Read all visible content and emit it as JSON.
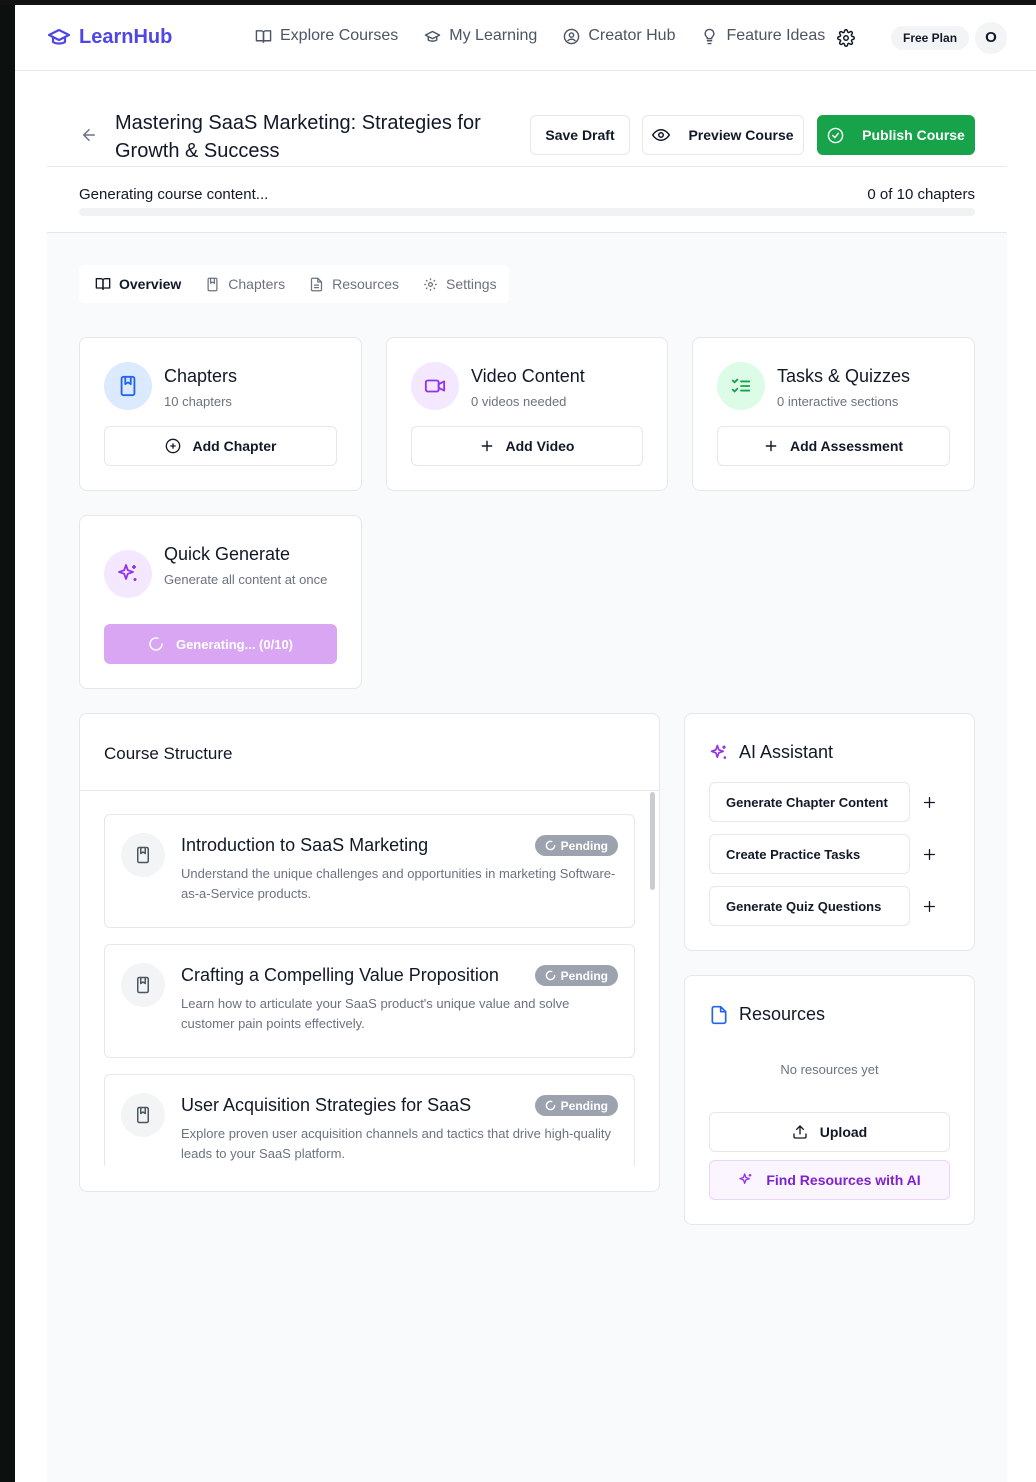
{
  "nav": {
    "brand": "LearnHub",
    "links": [
      {
        "label": "Explore Courses",
        "icon": "book-open-icon"
      },
      {
        "label": "My Learning",
        "icon": "graduation-cap-icon"
      },
      {
        "label": "Creator Hub",
        "icon": "user-circle-icon"
      },
      {
        "label": "Feature Ideas",
        "icon": "lightbulb-icon"
      }
    ],
    "plan": "Free Plan",
    "avatar_initial": "O"
  },
  "header": {
    "title": "Mastering SaaS Marketing: Strategies for Growth & Success",
    "save_label": "Save Draft",
    "preview_label": "Preview Course",
    "publish_label": "Publish Course",
    "progress_label": "Generating course content...",
    "progress_count": "0 of 10 chapters",
    "progress_fraction": 0
  },
  "tabs": [
    {
      "label": "Overview",
      "active": true
    },
    {
      "label": "Chapters",
      "active": false
    },
    {
      "label": "Resources",
      "active": false
    },
    {
      "label": "Settings",
      "active": false
    }
  ],
  "stats": {
    "chapters": {
      "title": "Chapters",
      "sub": "10 chapters",
      "button": "Add Chapter"
    },
    "videos": {
      "title": "Video Content",
      "sub": "0 videos needed",
      "button": "Add Video"
    },
    "tasks": {
      "title": "Tasks & Quizzes",
      "sub": "0 interactive sections",
      "button": "Add Assessment"
    },
    "quick": {
      "title": "Quick Generate",
      "sub": "Generate all content at once",
      "button": "Generating... (0/10)"
    }
  },
  "structure": {
    "title": "Course Structure",
    "chapters": [
      {
        "title": "Introduction to SaaS Marketing",
        "desc": "Understand the unique challenges and opportunities in marketing Software-as-a-Service products.",
        "status": "Pending"
      },
      {
        "title": "Crafting a Compelling Value Proposition",
        "desc": "Learn how to articulate your SaaS product's unique value and solve customer pain points effectively.",
        "status": "Pending"
      },
      {
        "title": "User Acquisition Strategies for SaaS",
        "desc": "Explore proven user acquisition channels and tactics that drive high-quality leads to your SaaS platform.",
        "status": "Pending"
      }
    ]
  },
  "ai": {
    "title": "AI Assistant",
    "actions": [
      "Generate Chapter Content",
      "Create Practice Tasks",
      "Generate Quiz Questions"
    ]
  },
  "resources": {
    "title": "Resources",
    "empty": "No resources yet",
    "upload": "Upload",
    "find_ai": "Find Resources with AI"
  },
  "colors": {
    "brand": "#4f46e5",
    "publish": "#16a34a",
    "ai_purple": "#9333ea",
    "pending": "#9ca3af"
  }
}
